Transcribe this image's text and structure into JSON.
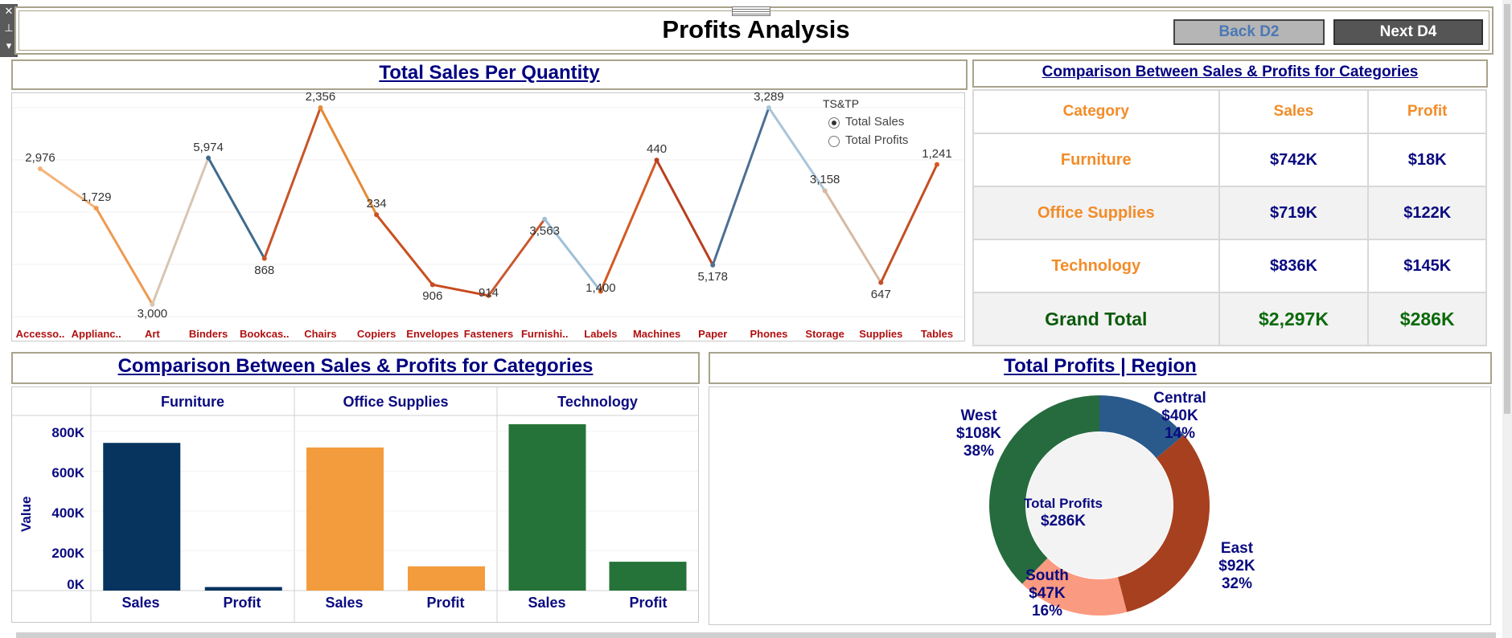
{
  "toolbar": {
    "close_icon": "close-icon",
    "pin_icon": "pin-icon",
    "menu_icon": "chevron-down-icon"
  },
  "header": {
    "title": "Profits Analysis",
    "back_label": "Back D2",
    "next_label": "Next D4"
  },
  "line_section": {
    "title": "Total Sales Per Quantity",
    "legend_title": "TS&TP",
    "options": [
      {
        "label": "Total Sales",
        "selected": true
      },
      {
        "label": "Total Profits",
        "selected": false
      }
    ]
  },
  "table_section": {
    "title": "Comparison Between Sales & Profits for Categories",
    "headers": [
      "Category",
      "Sales",
      "Profit"
    ],
    "rows": [
      {
        "category": "Furniture",
        "sales": "$742K",
        "profit": "$18K"
      },
      {
        "category": "Office Supplies",
        "sales": "$719K",
        "profit": "$122K"
      },
      {
        "category": "Technology",
        "sales": "$836K",
        "profit": "$145K"
      }
    ],
    "total": {
      "category": "Grand Total",
      "sales": "$2,297K",
      "profit": "$286K"
    }
  },
  "bar_section": {
    "title": "Comparison Between Sales & Profits for Categories",
    "ylabel": "Value"
  },
  "donut_section": {
    "title": "Total Profits | Region",
    "center_title": "Total Profits",
    "center_value": "$286K"
  },
  "colors": {
    "navy": "#0a0a80",
    "orange": "#f28c28",
    "green": "#0b6a0b",
    "dark_red": "#b01010"
  },
  "chart_data": [
    {
      "type": "line",
      "title": "Total Sales Per Quantity",
      "x": [
        "Accesso..",
        "Applianc..",
        "Art",
        "Binders",
        "Bookcas..",
        "Chairs",
        "Copiers",
        "Envelopes",
        "Fasteners",
        "Furnishi..",
        "Labels",
        "Machines",
        "Paper",
        "Phones",
        "Storage",
        "Supplies",
        "Tables"
      ],
      "series": [
        {
          "values": [
            2976,
            1729,
            3000,
            5974,
            868,
            2356,
            234,
            906,
            914,
            3563,
            1400,
            440,
            5178,
            3289,
            3158,
            647,
            1241
          ]
        }
      ],
      "labels": [
        "2,976",
        "1,729",
        "3,000",
        "5,974",
        "868",
        "2,356",
        "234",
        "906",
        "914",
        "3,563",
        "1,400",
        "440",
        "5,178",
        "3,289",
        "3,158",
        "647",
        "1,241"
      ],
      "line_levels": [
        0.72,
        0.54,
        0.1,
        0.77,
        0.31,
        1.0,
        0.51,
        0.19,
        0.14,
        0.49,
        0.16,
        0.76,
        0.28,
        1.0,
        0.62,
        0.2,
        0.74
      ]
    },
    {
      "type": "bar",
      "title": "Comparison Between Sales & Profits for Categories",
      "groups": [
        "Furniture",
        "Office Supplies",
        "Technology"
      ],
      "categories": [
        "Sales",
        "Profit"
      ],
      "series": [
        {
          "name": "Furniture",
          "values": [
            742,
            18
          ]
        },
        {
          "name": "Office Supplies",
          "values": [
            719,
            122
          ]
        },
        {
          "name": "Technology",
          "values": [
            836,
            145
          ]
        }
      ],
      "ylabel": "Value",
      "yticks": [
        "0K",
        "200K",
        "400K",
        "600K",
        "800K"
      ],
      "ylim": [
        0,
        880
      ]
    },
    {
      "type": "pie",
      "title": "Total Profits | Region",
      "slices": [
        {
          "name": "Central",
          "value": 40,
          "label": "$40K",
          "pct": "14%"
        },
        {
          "name": "East",
          "value": 92,
          "label": "$92K",
          "pct": "32%"
        },
        {
          "name": "South",
          "value": 47,
          "label": "$47K",
          "pct": "16%"
        },
        {
          "name": "West",
          "value": 108,
          "label": "$108K",
          "pct": "38%"
        }
      ]
    }
  ]
}
